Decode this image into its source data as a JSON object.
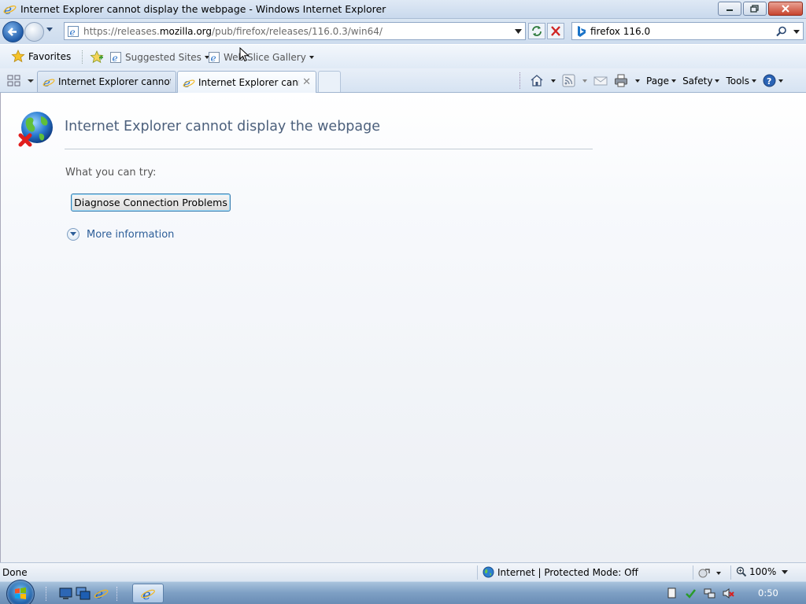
{
  "window": {
    "title": "Internet Explorer cannot display the webpage - Windows Internet Explorer"
  },
  "address_bar": {
    "url_prefix": "https://releases.",
    "url_domain": "mozilla.org",
    "url_suffix": "/pub/firefox/releases/116.0.3/win64/"
  },
  "search": {
    "query": "firefox 116.0"
  },
  "favorites_bar": {
    "favorites_label": "Favorites",
    "links": [
      {
        "label": "Suggested Sites"
      },
      {
        "label": "Web Slice Gallery"
      }
    ]
  },
  "tabs": [
    {
      "title": "Internet Explorer cannot di...",
      "active": false
    },
    {
      "title": "Internet Explorer canno...",
      "active": true
    }
  ],
  "command_bar": {
    "page_label": "Page",
    "safety_label": "Safety",
    "tools_label": "Tools"
  },
  "error_page": {
    "title": "Internet Explorer cannot display the webpage",
    "try_label": "What you can try:",
    "diagnose_button": "Diagnose Connection Problems",
    "more_info": "More information"
  },
  "status_bar": {
    "status": "Done",
    "zone": "Internet | Protected Mode: Off",
    "zoom": "100%"
  },
  "taskbar": {
    "clock": "0:50"
  },
  "colors": {
    "title_text": "#4c607c",
    "link": "#2d5e99",
    "close_button": "#c8452f"
  }
}
